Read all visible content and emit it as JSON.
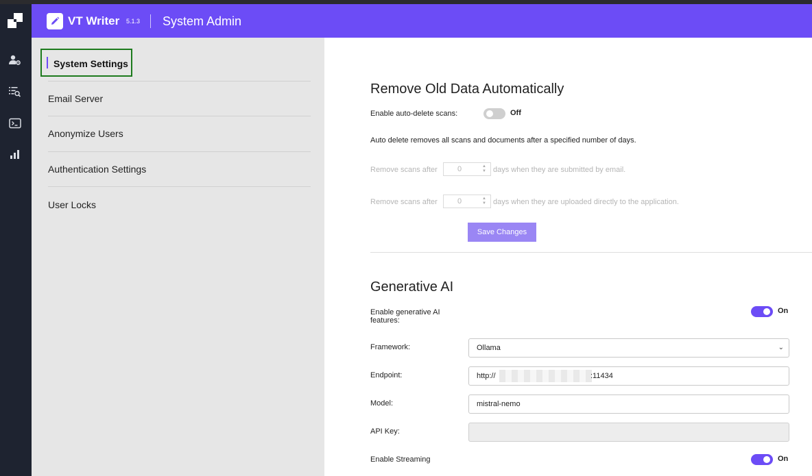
{
  "header": {
    "app_name": "VT Writer",
    "version": "5.1.3",
    "section_title": "System Admin",
    "accent_color": "#6c4cf6"
  },
  "rail": {
    "icons": [
      "logo-icon",
      "user-settings-icon",
      "search-list-icon",
      "terminal-icon",
      "bar-chart-icon"
    ]
  },
  "nav": {
    "items": [
      {
        "label": "System Settings",
        "active": true
      },
      {
        "label": "Email Server"
      },
      {
        "label": "Anonymize Users"
      },
      {
        "label": "Authentication Settings"
      },
      {
        "label": "User Locks"
      }
    ]
  },
  "auto_delete": {
    "title": "Remove Old Data Automatically",
    "toggle_label": "Enable auto-delete scans:",
    "toggle_state": "Off",
    "description": "Auto delete removes all scans and documents after a specified number of days.",
    "email_prefix": "Remove scans after",
    "email_value": "0",
    "email_suffix": "days when they are submitted by email.",
    "upload_prefix": "Remove scans after",
    "upload_value": "0",
    "upload_suffix": "days when they are uploaded directly to the application.",
    "save_label": "Save Changes"
  },
  "gen_ai": {
    "title": "Generative AI",
    "enable_label_line1": "Enable generative AI",
    "enable_label_line2": "features:",
    "enable_state": "On",
    "framework_label": "Framework:",
    "framework_value": "Ollama",
    "endpoint_label": "Endpoint:",
    "endpoint_prefix": "http://",
    "endpoint_suffix": ":11434",
    "model_label": "Model:",
    "model_value": "mistral-nemo",
    "api_key_label": "API Key:",
    "api_key_value": "",
    "streaming_label": "Enable Streaming",
    "streaming_state": "On"
  }
}
